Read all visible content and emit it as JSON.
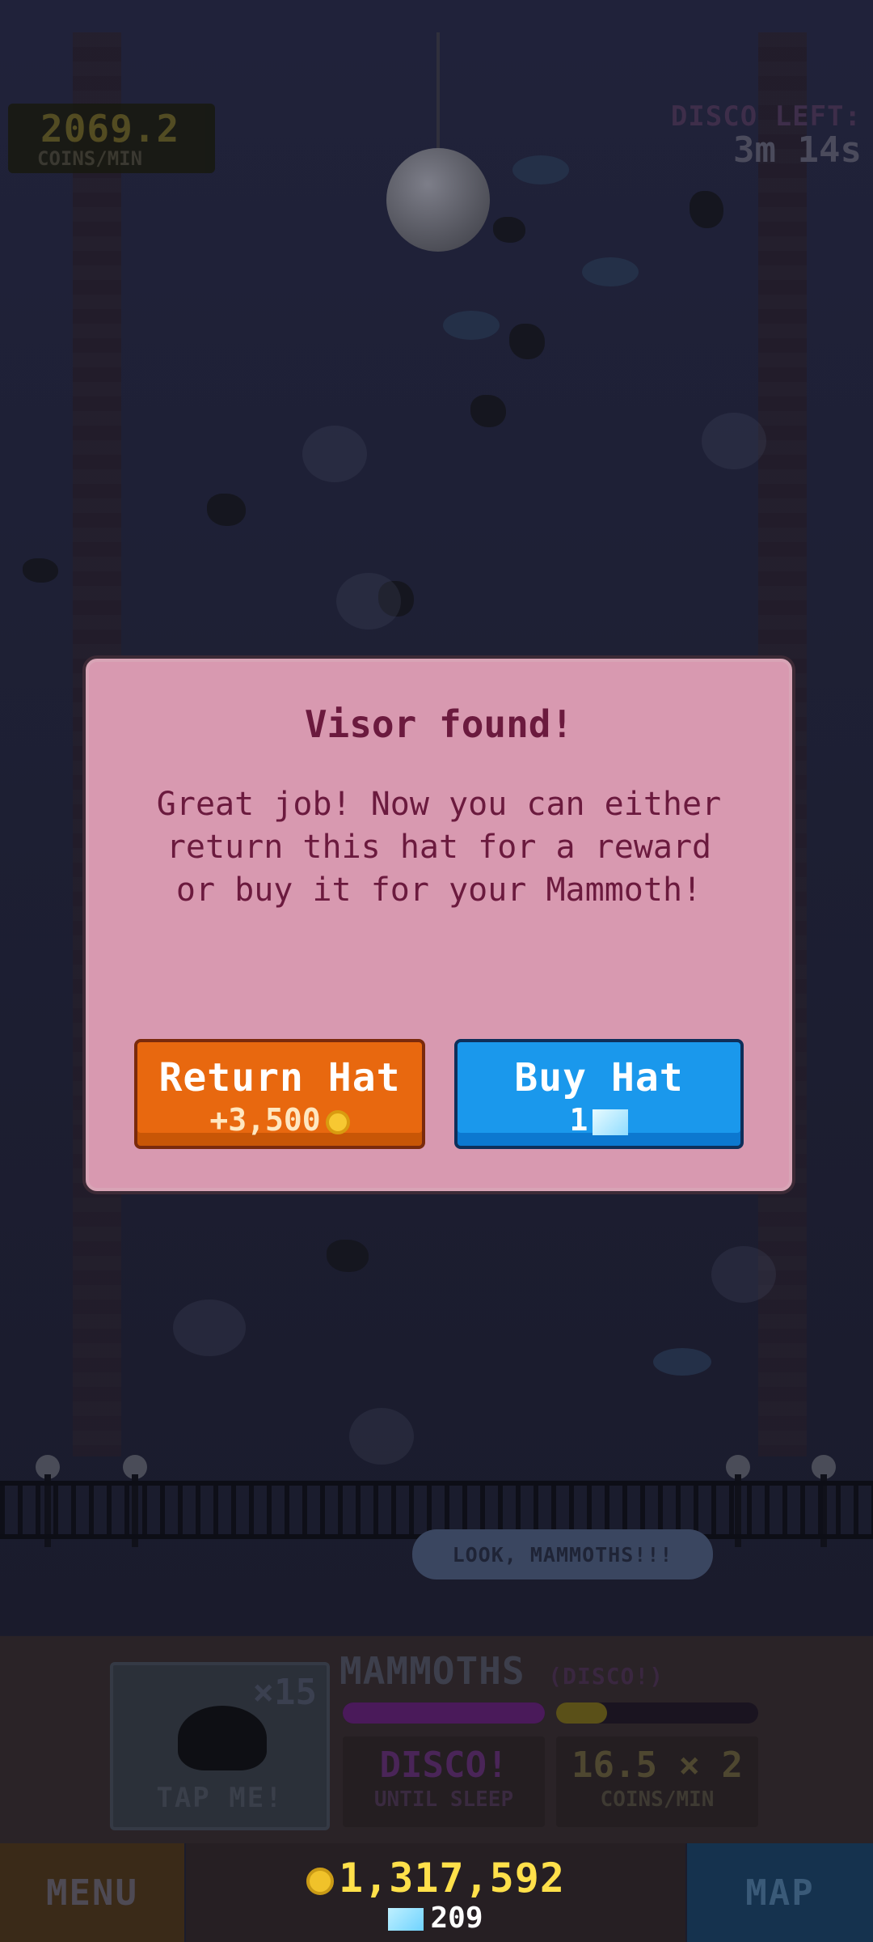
{
  "hud": {
    "coins_per_min_value": "2069.2",
    "coins_per_min_unit": "COINS/MIN",
    "disco_left_label": "DISCO LEFT:",
    "disco_left_time": "3m 14s"
  },
  "scene": {
    "speech_bubble": "LOOK, MAMMOTHS!!!"
  },
  "dialog": {
    "title": "Visor found!",
    "body": "Great job! Now you can either return this hat for a reward or buy it for your Mammoth!",
    "return_button": {
      "label": "Return Hat",
      "reward": "+3,500",
      "icon": "coin-icon"
    },
    "buy_button": {
      "label": "Buy Hat",
      "price": "1",
      "icon": "gem-icon"
    }
  },
  "panel": {
    "tap_card": {
      "multiplier": "×15",
      "label": "TAP ME!"
    },
    "title": "MAMMOTHS",
    "title_sub": "(DISCO!)",
    "progress": {
      "disco_fill": 1.0,
      "coins_fill": 0.25
    },
    "stat_left": {
      "big": "DISCO!",
      "small": "UNTIL SLEEP"
    },
    "stat_right": {
      "big": "16.5 × 2",
      "small": "COINS/MIN"
    }
  },
  "bottom_bar": {
    "menu_label": "MENU",
    "coins": "1,317,592",
    "gems": "209",
    "map_label": "MAP"
  },
  "colors": {
    "dialog_bg": "#d899b0",
    "dialog_text": "#6b1a3e",
    "return_button": "#e8680f",
    "buy_button": "#1a98ec",
    "coins_text": "#ffe04a"
  }
}
